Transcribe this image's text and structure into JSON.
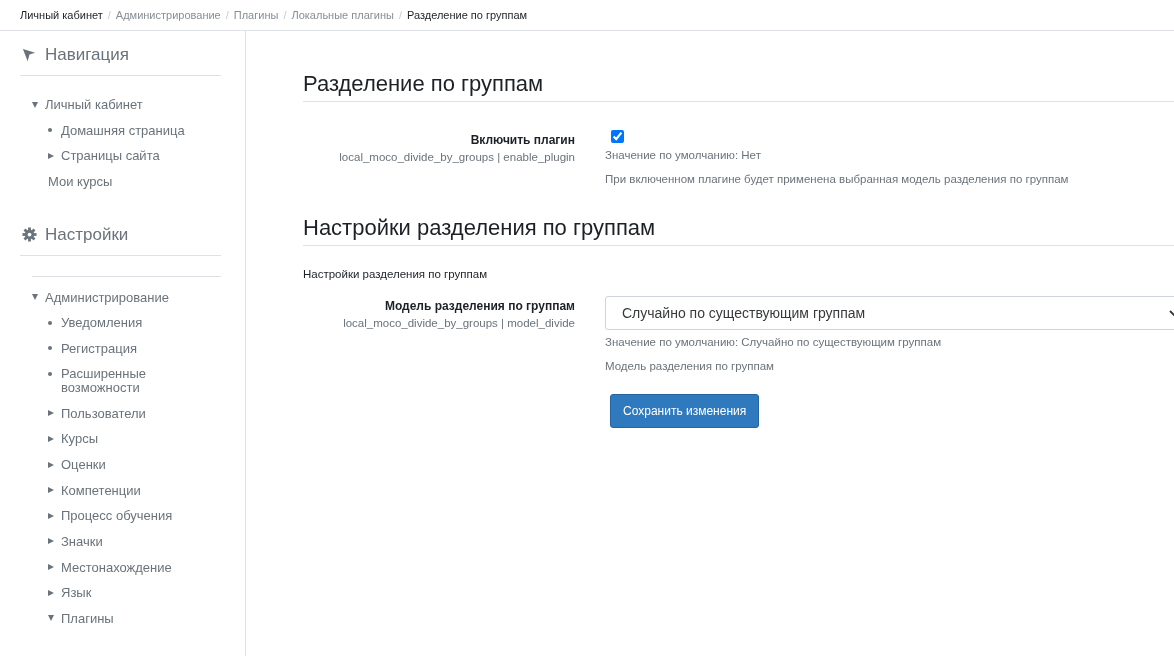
{
  "breadcrumb": [
    {
      "label": "Личный кабинет",
      "kind": "link",
      "separator": "/"
    },
    {
      "label": "Администрирование",
      "kind": "muted",
      "separator": "/"
    },
    {
      "label": "Плагины",
      "kind": "muted",
      "separator": "/"
    },
    {
      "label": "Локальные плагины",
      "kind": "muted",
      "separator": "/"
    },
    {
      "label": "Разделение по группам",
      "kind": "current"
    }
  ],
  "sidebar": {
    "blocks": [
      {
        "title": "Навигация",
        "items": [
          {
            "label": "Личный кабинет",
            "kind": "branch",
            "expanded": true,
            "children": [
              {
                "label": "Домашняя страница",
                "kind": "leaf"
              },
              {
                "label": "Страницы сайта",
                "kind": "branch",
                "expanded": false
              },
              {
                "label": "Мои курсы",
                "kind": "plain"
              }
            ]
          }
        ]
      },
      {
        "title": "Настройки",
        "items": [
          {
            "label": "Администрирование",
            "kind": "branch",
            "expanded": true,
            "children": [
              {
                "label": "Уведомления",
                "kind": "leaf"
              },
              {
                "label": "Регистрация",
                "kind": "leaf"
              },
              {
                "label": "Расширенные возможности",
                "kind": "leaf"
              },
              {
                "label": "Пользователи",
                "kind": "branch",
                "expanded": false
              },
              {
                "label": "Курсы",
                "kind": "branch",
                "expanded": false
              },
              {
                "label": "Оценки",
                "kind": "branch",
                "expanded": false
              },
              {
                "label": "Компетенции",
                "kind": "branch",
                "expanded": false
              },
              {
                "label": "Процесс обучения",
                "kind": "branch",
                "expanded": false
              },
              {
                "label": "Значки",
                "kind": "branch",
                "expanded": false
              },
              {
                "label": "Местонахождение",
                "kind": "branch",
                "expanded": false
              },
              {
                "label": "Язык",
                "kind": "branch",
                "expanded": false
              },
              {
                "label": "Плагины",
                "kind": "branch",
                "expanded": true
              }
            ]
          }
        ]
      }
    ]
  },
  "sections": [
    {
      "heading": "Разделение по группам",
      "settings": [
        {
          "kind": "checkbox",
          "label": "Включить плагин",
          "id": "local_moco_divide_by_groups | enable_plugin",
          "checked": true,
          "default": "Значение по умолчанию: Нет",
          "description": "При включенном плагине будет применена выбранная модель разделения по группам"
        }
      ]
    },
    {
      "heading": "Настройки разделения по группам",
      "intro": "Настройки разделения по группам",
      "settings": [
        {
          "kind": "select",
          "label": "Модель разделения по группам",
          "id": "local_moco_divide_by_groups | model_divide",
          "value": "Случайно по существующим группам",
          "default": "Значение по умолчанию: Случайно по существующим группам",
          "description": "Модель разделения по группам"
        }
      ]
    }
  ],
  "save_button": "Сохранить изменения"
}
